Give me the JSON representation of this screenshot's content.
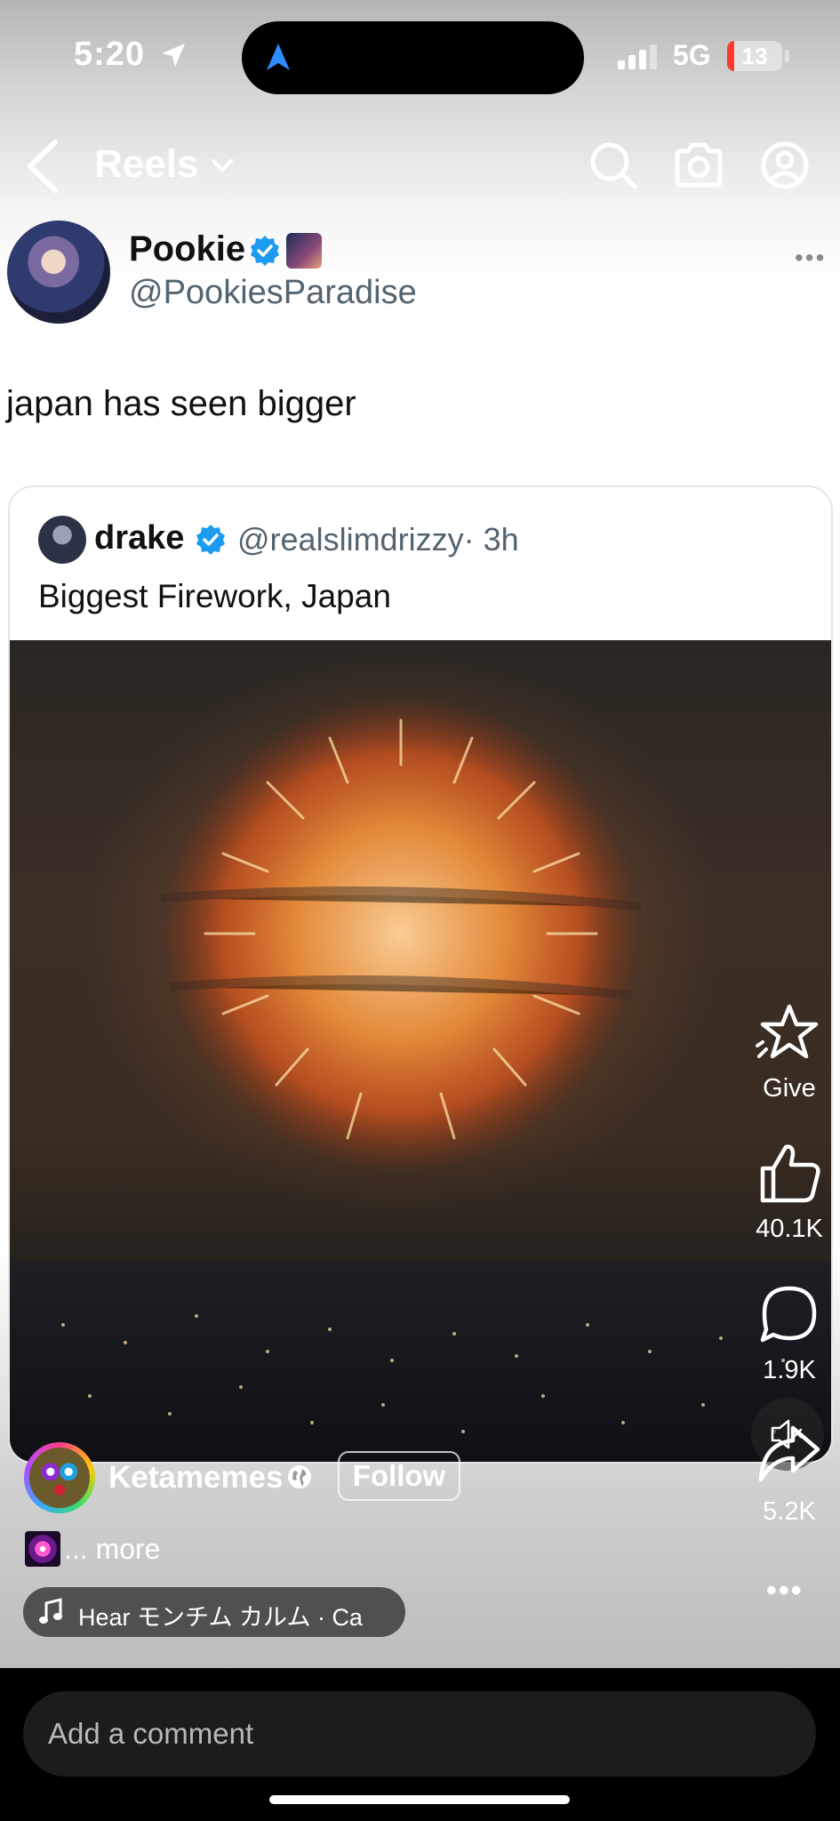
{
  "status_bar": {
    "time": "5:20",
    "network": "5G",
    "battery": "13",
    "battery_color": "#ff3b30"
  },
  "header": {
    "title": "Reels",
    "icons": [
      "back-icon",
      "chevron-down-icon",
      "search-icon",
      "camera-icon",
      "profile-icon"
    ]
  },
  "post": {
    "author_name": "Pookie",
    "author_handle": "@PookiesParadise",
    "text": "japan has seen bigger",
    "quote": {
      "author_name": "drake",
      "author_handle": "@realslimdrizzy",
      "time": "· 3h",
      "text": "Biggest Firework, Japan"
    }
  },
  "actions": {
    "give_label": "Give",
    "likes": "40.1K",
    "comments": "1.9K",
    "shares": "5.2K",
    "more": "•••"
  },
  "creator": {
    "name": "Ketamemes",
    "follow_label": "Follow",
    "caption_more": "... more",
    "audio": "Hear     モンチム カルム · Ca"
  },
  "comment": {
    "placeholder": "Add a comment"
  },
  "colors": {
    "verified_blue": "#1d9bf0",
    "handle_gray": "#536471"
  }
}
